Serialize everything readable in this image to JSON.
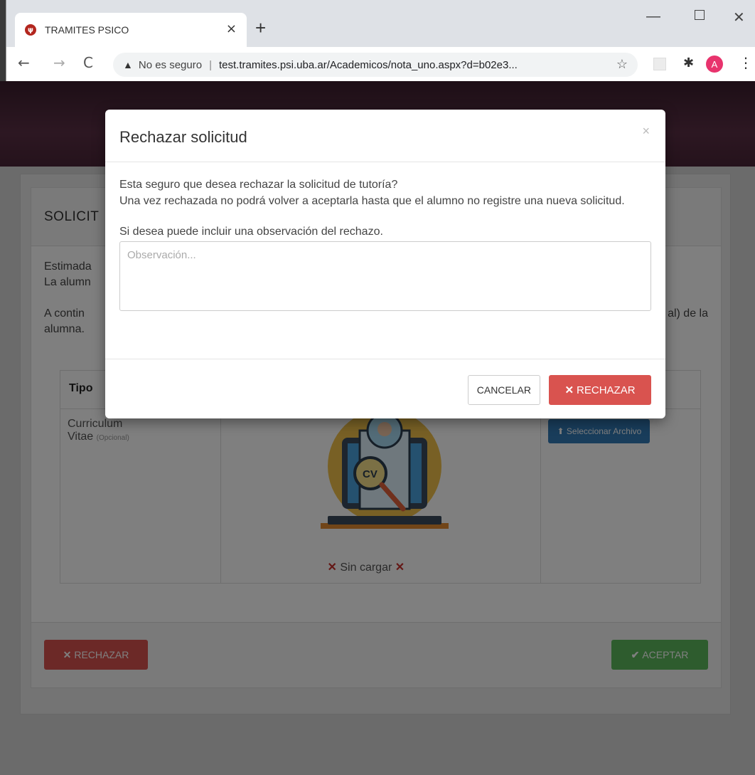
{
  "browser": {
    "tab_title": "TRAMITES PSICO",
    "tab_close": "×",
    "new_tab": "+",
    "security_label": "No es seguro",
    "separator": "|",
    "url": "test.tramites.psi.uba.ar/Academicos/nota_uno.aspx?d=b02e3...",
    "avatar_initial": "A"
  },
  "page": {
    "panel_title": "SOLICITUD DE TUTORÍA",
    "panel_title_visible": "SOLICIT",
    "greeting_line1": "Estimada",
    "greeting_line2": "La alumn",
    "intro_line1": "A contin",
    "intro_right": "al) de la",
    "intro_line2": "alumna.",
    "table_header_tipo": "Tipo",
    "doc_type_line1": "Curriculum",
    "doc_type_line2": "Vitae",
    "doc_optional": "(Opcional)",
    "select_file_label": "Seleccionar Archivo",
    "not_loaded_label": "Sin cargar",
    "reject_label": "RECHAZAR",
    "accept_label": "ACEPTAR"
  },
  "modal": {
    "title": "Rechazar solicitud",
    "close": "×",
    "message_line1": "Esta seguro que desea rechazar la solicitud de tutoría?",
    "message_line2": "Una vez rechazada no podrá volver a aceptarla hasta que el alumno no registre una nueva solicitud.",
    "obs_label": "Si desea puede incluir una observación del rechazo.",
    "obs_placeholder": "Observación...",
    "obs_value": "",
    "cancel_label": "CANCELAR",
    "reject_label": "RECHAZAR"
  },
  "icons": {
    "back": "back-arrow-icon",
    "forward": "forward-arrow-icon",
    "reload": "reload-icon",
    "warning": "warning-icon",
    "star": "star-icon",
    "extensions": "puzzle-icon",
    "menu": "kebab-menu-icon"
  },
  "colors": {
    "danger": "#d9534f",
    "success": "#5cb85c",
    "primary": "#337ab7",
    "avatar": "#e8336d"
  }
}
